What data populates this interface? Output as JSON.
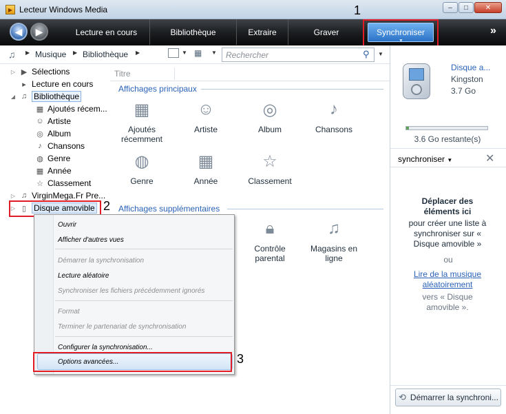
{
  "window": {
    "title": "Lecteur Windows Media",
    "minimize_glyph": "–",
    "maximize_glyph": "□",
    "close_glyph": "✕"
  },
  "navbar": {
    "back_glyph": "◀",
    "forward_glyph": "▶",
    "tabs": [
      {
        "label": "Lecture en cours"
      },
      {
        "label": "Bibliothèque"
      },
      {
        "label": "Extraire"
      },
      {
        "label": "Graver"
      },
      {
        "label": "Synchroniser"
      }
    ],
    "more_glyph": "»"
  },
  "address": {
    "crumb1": "Musique",
    "crumb2": "Bibliothèque",
    "search_placeholder": "Rechercher"
  },
  "tree": {
    "items": [
      {
        "label": "Sélections"
      },
      {
        "label": "Lecture en cours"
      },
      {
        "label": "Bibliothèque"
      },
      {
        "label": "Ajoutés récem..."
      },
      {
        "label": "Artiste"
      },
      {
        "label": "Album"
      },
      {
        "label": "Chansons"
      },
      {
        "label": "Genre"
      },
      {
        "label": "Année"
      },
      {
        "label": "Classement"
      },
      {
        "label": "VirginMega.Fr Pre..."
      },
      {
        "label": "Disque amovible"
      }
    ]
  },
  "content": {
    "column_header": "Titre",
    "main_section": "Affichages principaux",
    "main_views": [
      {
        "label": "Ajoutés récemment"
      },
      {
        "label": "Artiste"
      },
      {
        "label": "Album"
      },
      {
        "label": "Chansons"
      },
      {
        "label": "Genre"
      },
      {
        "label": "Année"
      },
      {
        "label": "Classement"
      }
    ],
    "extra_section": "Affichages supplémentaires",
    "extra_views": [
      {
        "label": "Contrôle parental"
      },
      {
        "label": "Magasins en ligne"
      }
    ]
  },
  "context_menu": {
    "items": [
      {
        "label": "Ouvrir",
        "disabled": false
      },
      {
        "label": "Afficher d'autres vues",
        "disabled": false
      },
      {
        "label": "Démarrer la synchronisation",
        "disabled": true
      },
      {
        "label": "Lecture aléatoire",
        "disabled": false
      },
      {
        "label": "Synchroniser les fichiers précédemment ignorés",
        "disabled": true
      },
      {
        "label": "Format",
        "disabled": true
      },
      {
        "label": "Terminer le partenariat de synchronisation",
        "disabled": true
      },
      {
        "label": "Configurer la synchronisation...",
        "disabled": false
      },
      {
        "label": "Options avancées...",
        "disabled": false
      }
    ]
  },
  "device_panel": {
    "device_name": "Disque a...",
    "brand": "Kingston",
    "capacity": "3.7 Go",
    "remaining": "3.6 Go restante(s)",
    "capacity_used_fraction": 0.03,
    "sync_dropdown": "synchroniser",
    "drop_title": "Déplacer des éléments ici",
    "drop_text": "pour créer une liste à synchroniser sur « Disque amovible »",
    "or_text": "ou",
    "shuffle_link": "Lire de la musique aléatoirement",
    "shuffle_suffix": "vers « Disque amovible ».",
    "start_sync_button": "Démarrer la synchroni..."
  },
  "annotations": {
    "n1": "1",
    "n2": "2",
    "n3": "3"
  },
  "colors": {
    "accent": "#2a62b8",
    "callout_red": "#e21b24",
    "sync_tab": "#2a72c6"
  }
}
